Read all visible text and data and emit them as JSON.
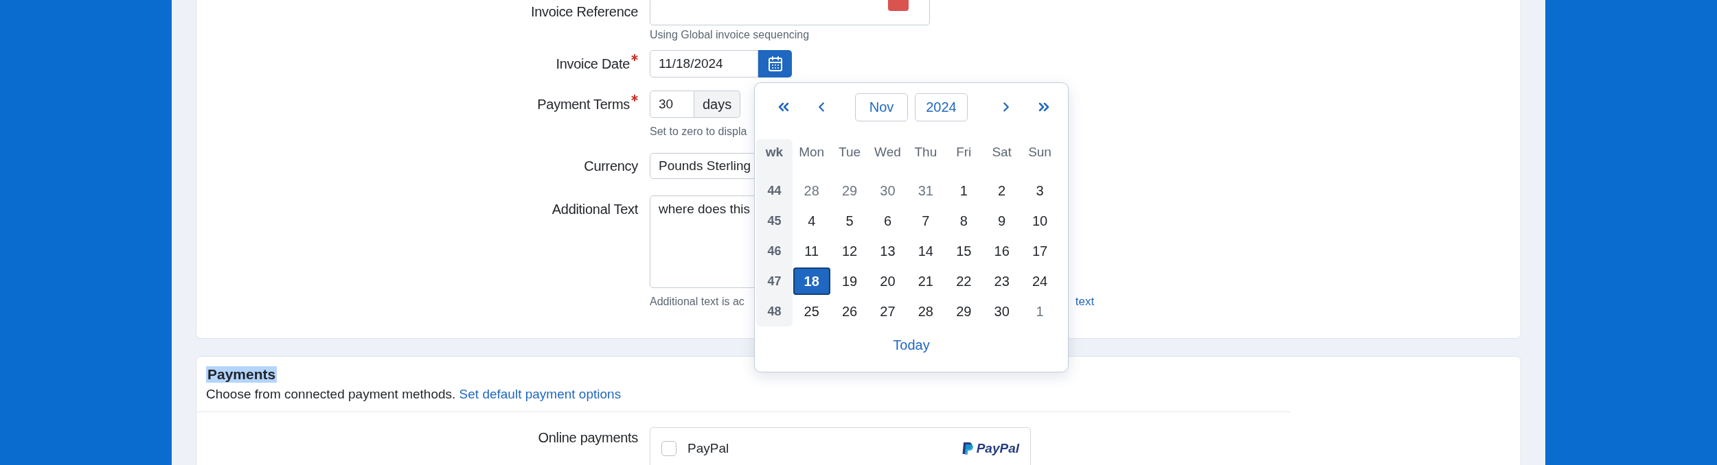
{
  "invoice_form": {
    "reference": {
      "label": "Invoice Reference",
      "hint": "Using Global invoice sequencing"
    },
    "invoice_date": {
      "label": "Invoice Date",
      "required": true,
      "value": "11/18/2024"
    },
    "payment_terms": {
      "label": "Payment Terms",
      "required": true,
      "value": "30",
      "unit": "days",
      "hint": "Set to zero to displa"
    },
    "currency": {
      "label": "Currency",
      "value": "Pounds Sterling"
    },
    "additional_text": {
      "label": "Additional Text",
      "value": "where does this",
      "hint": "Additional text is ac",
      "hint_link": "text"
    }
  },
  "date_picker": {
    "month": "Nov",
    "year": "2024",
    "week_heading": "wk",
    "weekdays": [
      "Mon",
      "Tue",
      "Wed",
      "Thu",
      "Fri",
      "Sat",
      "Sun"
    ],
    "weeks": [
      {
        "week": "44",
        "days": [
          {
            "label": "28",
            "outside_month": true,
            "selected": false
          },
          {
            "label": "29",
            "outside_month": true,
            "selected": false
          },
          {
            "label": "30",
            "outside_month": true,
            "selected": false
          },
          {
            "label": "31",
            "outside_month": true,
            "selected": false
          },
          {
            "label": "1",
            "outside_month": false,
            "selected": false
          },
          {
            "label": "2",
            "outside_month": false,
            "selected": false
          },
          {
            "label": "3",
            "outside_month": false,
            "selected": false
          }
        ]
      },
      {
        "week": "45",
        "days": [
          {
            "label": "4",
            "outside_month": false,
            "selected": false
          },
          {
            "label": "5",
            "outside_month": false,
            "selected": false
          },
          {
            "label": "6",
            "outside_month": false,
            "selected": false
          },
          {
            "label": "7",
            "outside_month": false,
            "selected": false
          },
          {
            "label": "8",
            "outside_month": false,
            "selected": false
          },
          {
            "label": "9",
            "outside_month": false,
            "selected": false
          },
          {
            "label": "10",
            "outside_month": false,
            "selected": false
          }
        ]
      },
      {
        "week": "46",
        "days": [
          {
            "label": "11",
            "outside_month": false,
            "selected": false
          },
          {
            "label": "12",
            "outside_month": false,
            "selected": false
          },
          {
            "label": "13",
            "outside_month": false,
            "selected": false
          },
          {
            "label": "14",
            "outside_month": false,
            "selected": false
          },
          {
            "label": "15",
            "outside_month": false,
            "selected": false
          },
          {
            "label": "16",
            "outside_month": false,
            "selected": false
          },
          {
            "label": "17",
            "outside_month": false,
            "selected": false
          }
        ]
      },
      {
        "week": "47",
        "days": [
          {
            "label": "18",
            "outside_month": false,
            "selected": true
          },
          {
            "label": "19",
            "outside_month": false,
            "selected": false
          },
          {
            "label": "20",
            "outside_month": false,
            "selected": false
          },
          {
            "label": "21",
            "outside_month": false,
            "selected": false
          },
          {
            "label": "22",
            "outside_month": false,
            "selected": false
          },
          {
            "label": "23",
            "outside_month": false,
            "selected": false
          },
          {
            "label": "24",
            "outside_month": false,
            "selected": false
          }
        ]
      },
      {
        "week": "48",
        "days": [
          {
            "label": "25",
            "outside_month": false,
            "selected": false
          },
          {
            "label": "26",
            "outside_month": false,
            "selected": false
          },
          {
            "label": "27",
            "outside_month": false,
            "selected": false
          },
          {
            "label": "28",
            "outside_month": false,
            "selected": false
          },
          {
            "label": "29",
            "outside_month": false,
            "selected": false
          },
          {
            "label": "30",
            "outside_month": false,
            "selected": false
          },
          {
            "label": "1",
            "outside_month": true,
            "selected": false
          }
        ]
      }
    ],
    "today_button": "Today"
  },
  "payments": {
    "title": "Payments",
    "description": "Choose from connected payment methods.",
    "link": "Set default payment options",
    "online_payments": {
      "label": "Online payments",
      "methods": [
        {
          "name": "PayPal",
          "checked": false,
          "logo_text": "PayPal"
        }
      ]
    }
  }
}
